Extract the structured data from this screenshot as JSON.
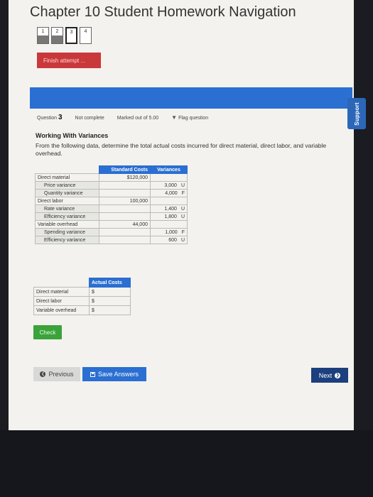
{
  "nav": {
    "title": "Chapter 10 Student Homework Navigation",
    "questions": [
      "1",
      "2",
      "3",
      "4"
    ],
    "finish_label": "Finish attempt ..."
  },
  "support_label": "Support",
  "question": {
    "label": "Question",
    "number": "3",
    "status": "Not complete",
    "marked": "Marked out of 5.00",
    "flag_label": "Flag question",
    "heading": "Working With Variances",
    "text": "From the following data, determine the total actual costs incurred for direct material, direct labor, and variable overhead."
  },
  "standard_table": {
    "headers": [
      "Standard Costs",
      "Variances"
    ],
    "rows": [
      {
        "label": "Direct material",
        "standard": "$120,000",
        "variance": "",
        "vtype": ""
      },
      {
        "label": "Price variance",
        "standard": "",
        "variance": "3,000",
        "vtype": "U"
      },
      {
        "label": "Quantity variance",
        "standard": "",
        "variance": "4,000",
        "vtype": "F"
      },
      {
        "label": "Direct labor",
        "standard": "100,000",
        "variance": "",
        "vtype": ""
      },
      {
        "label": "Rate variance",
        "standard": "",
        "variance": "1,400",
        "vtype": "U"
      },
      {
        "label": "Efficiency variance",
        "standard": "",
        "variance": "1,800",
        "vtype": "U"
      },
      {
        "label": "Variable overhead",
        "standard": "44,000",
        "variance": "",
        "vtype": ""
      },
      {
        "label": "Spending variance",
        "standard": "",
        "variance": "1,000",
        "vtype": "F"
      },
      {
        "label": "Efficiency variance",
        "standard": "",
        "variance": "600",
        "vtype": "U"
      }
    ]
  },
  "actual_table": {
    "header": "Actual Costs",
    "rows": [
      {
        "label": "Direct material",
        "prefix": "$",
        "value": ""
      },
      {
        "label": "Direct labor",
        "prefix": "$",
        "value": ""
      },
      {
        "label": "Variable overhead",
        "prefix": "$",
        "value": ""
      }
    ]
  },
  "buttons": {
    "check": "Check",
    "previous": "Previous",
    "save": "Save Answers",
    "next": "Next"
  },
  "colors": {
    "accent": "#2a6fd1",
    "finish": "#c9383a",
    "check": "#3aa33a",
    "next": "#1c3f7d"
  }
}
